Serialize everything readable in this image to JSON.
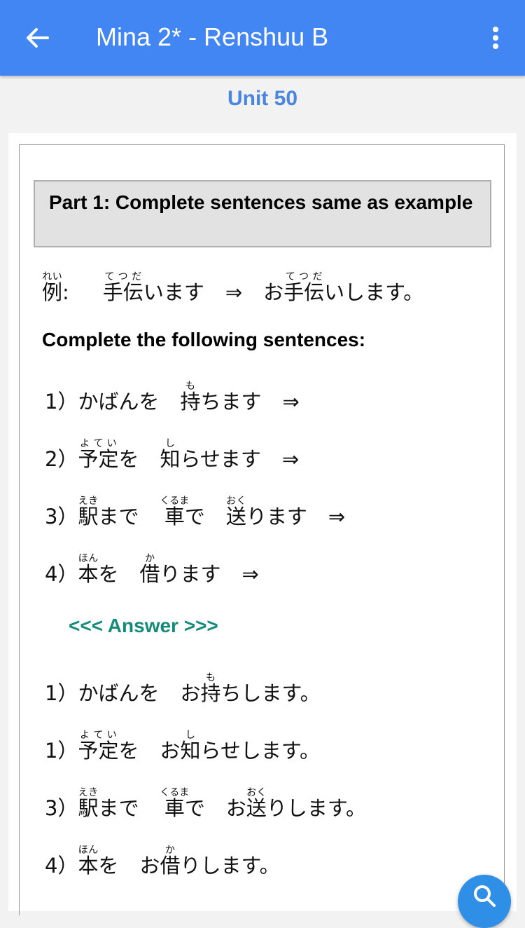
{
  "app_bar": {
    "title": "Mina 2* - Renshuu B",
    "back_icon": "arrow-left-icon",
    "menu_icon": "more-vertical-icon"
  },
  "unit_title": "Unit 50",
  "part": {
    "header": "Part 1: Complete sentences same as example"
  },
  "example": {
    "label": "例",
    "label_reading": "れい",
    "colon": ":",
    "verb_kanji": "手伝",
    "verb_reading": "てつだ",
    "verb_rest": "います",
    "arrow": "⇒",
    "ans_prefix": "お",
    "ans_kanji": "手伝",
    "ans_reading": "てつだ",
    "ans_rest": "いします。"
  },
  "instruction": "Complete the following sentences:",
  "questions": [
    {
      "num": "1）",
      "noun": "かばんを",
      "verb_kanji": "持",
      "verb_reading": "も",
      "verb_rest": "ちます",
      "arrow": "⇒"
    },
    {
      "num": "2）",
      "noun_kanji": "予定",
      "noun_reading": "よてい",
      "noun_rest": "を",
      "verb_kanji": "知",
      "verb_reading": "し",
      "verb_rest": "らせます",
      "arrow": "⇒"
    },
    {
      "num": "3）",
      "noun_kanji": "駅",
      "noun_reading": "えき",
      "noun_rest": "まで",
      "mid_kanji": "車",
      "mid_reading": "くるま",
      "mid_rest": "で",
      "verb_kanji": "送",
      "verb_reading": "おく",
      "verb_rest": "ります",
      "arrow": "⇒"
    },
    {
      "num": "4）",
      "noun_kanji": "本",
      "noun_reading": "ほん",
      "noun_rest": "を",
      "verb_kanji": "借",
      "verb_reading": "か",
      "verb_rest": "ります",
      "arrow": "⇒"
    }
  ],
  "answer_toggle": "<<< Answer >>>",
  "answers": [
    {
      "num": "1）",
      "noun": "かばんを",
      "prefix": "お",
      "verb_kanji": "持",
      "verb_reading": "も",
      "verb_rest": "ちします。"
    },
    {
      "num": "1）",
      "noun_kanji": "予定",
      "noun_reading": "よてい",
      "noun_rest": "を",
      "prefix": "お",
      "verb_kanji": "知",
      "verb_reading": "し",
      "verb_rest": "らせします。"
    },
    {
      "num": "3）",
      "noun_kanji": "駅",
      "noun_reading": "えき",
      "noun_rest": "まで",
      "mid_kanji": "車",
      "mid_reading": "くるま",
      "mid_rest": "で",
      "prefix": "お",
      "verb_kanji": "送",
      "verb_reading": "おく",
      "verb_rest": "りします。"
    },
    {
      "num": "4）",
      "noun_kanji": "本",
      "noun_reading": "ほん",
      "noun_rest": "を",
      "prefix": "お",
      "verb_kanji": "借",
      "verb_reading": "か",
      "verb_rest": "りします。"
    }
  ],
  "fab": {
    "icon": "search-icon"
  },
  "colors": {
    "app_bar": "#4286f4",
    "unit_title": "#4a86e0",
    "answer_toggle": "#138a7a",
    "fab": "#2f8ee6"
  }
}
